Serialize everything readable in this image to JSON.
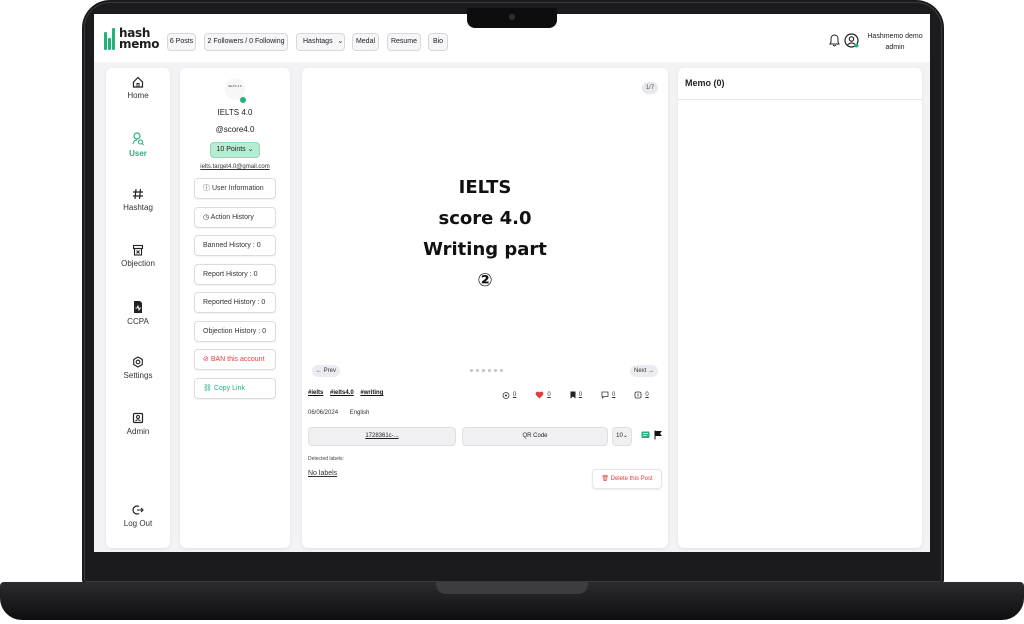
{
  "header": {
    "logo_line1": "hash",
    "logo_line2": "memo",
    "posts": "6 Posts",
    "followers": "2 Followers / 0 Following",
    "hashtags": "Hashtags",
    "medal": "Medal",
    "resume": "Resume",
    "bio": "Bio",
    "user_name": "Hashmemo demo",
    "user_role": "admin"
  },
  "nav": {
    "items": [
      {
        "label": "Home",
        "icon": "home-icon"
      },
      {
        "label": "User",
        "icon": "user-icon"
      },
      {
        "label": "Hashtag",
        "icon": "hashtag-icon"
      },
      {
        "label": "Objection",
        "icon": "objection-icon"
      },
      {
        "label": "CCPA",
        "icon": "ccpa-icon"
      },
      {
        "label": "Settings",
        "icon": "settings-icon"
      },
      {
        "label": "Admin",
        "icon": "admin-icon"
      }
    ],
    "logout": "Log Out",
    "active_color": "#21b37a"
  },
  "profile": {
    "avatar_text": "IELTS 4.0",
    "title": "IELTS 4.0",
    "handle": "@score4.0",
    "points": "10 Points",
    "email": "ielts.target4.0@gmail.com",
    "buttons": {
      "user_info": "User Information",
      "action_history": "Action History",
      "banned_history": "Banned History : 0",
      "report_history": "Report History : 0",
      "reported_history": "Reported History : 0",
      "objection_history": "Objection History : 0",
      "ban": "BAN this account",
      "copy_link": "Copy Link"
    }
  },
  "post": {
    "counter": "1/7",
    "image_lines": [
      "IELTS",
      "score 4.0",
      "Writing part",
      "②"
    ],
    "prev": "← Prev",
    "next": "Next →",
    "tags": [
      "#ielts",
      "#ielts4.0",
      "#writing"
    ],
    "stats": {
      "views": "0",
      "likes": "0",
      "bookmarks": "0",
      "comments": "0",
      "shares": "0"
    },
    "date": "06/06/2024",
    "language": "English",
    "link_button": "1728361c-...",
    "qr_button": "QR Code",
    "select_value": "10",
    "detected_labels": "Detected labels:",
    "no_labels": "No labels",
    "delete": "Delete this Post"
  },
  "memo": {
    "title": "Memo (0)"
  },
  "colors": {
    "accent": "#21b37a",
    "danger": "#e03c3c",
    "like": "#e03c3c"
  }
}
